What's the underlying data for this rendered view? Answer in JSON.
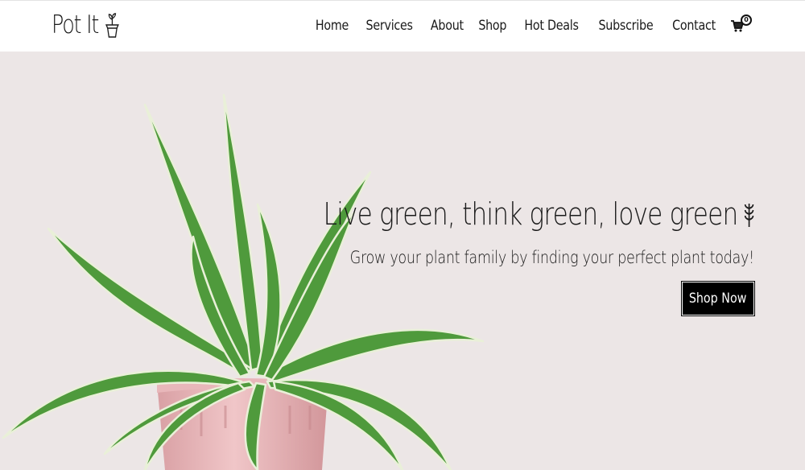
{
  "brand": {
    "name": "Pot It",
    "icon": "potted-sprout-icon"
  },
  "nav": {
    "links": [
      "Home",
      "Services",
      "About",
      "Shop",
      "Hot Deals",
      "Subscribe",
      "Contact"
    ],
    "cart": {
      "icon": "cart-icon",
      "count": "0"
    }
  },
  "hero": {
    "title": "Live green, think green, love green",
    "title_icon": "wheat-leaf-icon",
    "subtitle": "Grow your plant family by finding your perfect plant today!",
    "cta_label": "Shop Now",
    "background_color": "#ece6e6",
    "image": "spider-plant-in-pink-pot"
  },
  "colors": {
    "accent": "#000000",
    "text": "#1a1a1a",
    "nav_bg": "#ffffff"
  }
}
